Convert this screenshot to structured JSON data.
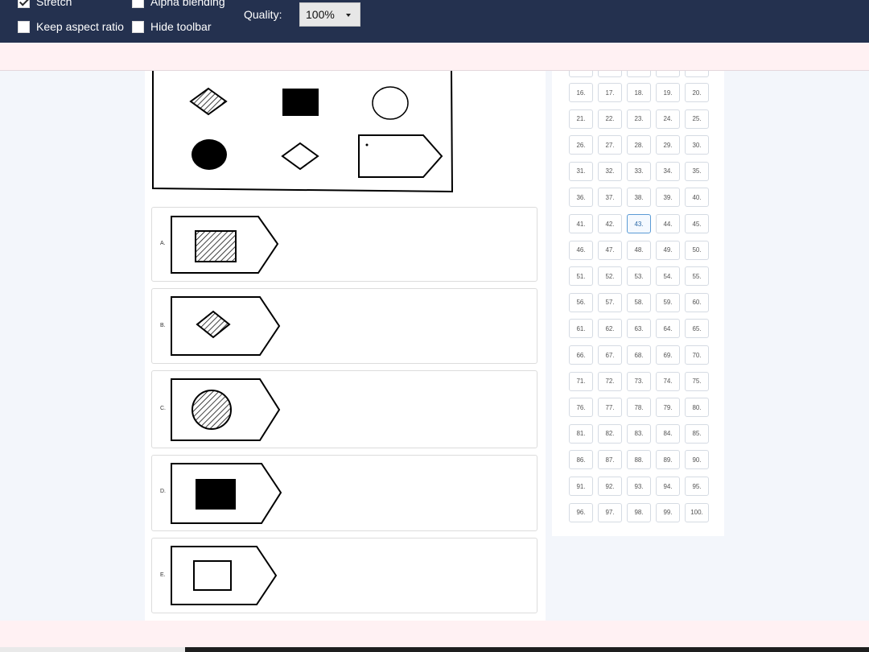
{
  "toolbar": {
    "stretch_label": "Stretch",
    "alpha_blending_label": "Alpha blending",
    "keep_aspect_label": "Keep aspect ratio",
    "hide_toolbar_label": "Hide toolbar",
    "quality_label": "Quality:",
    "quality_value": "100%",
    "stretch_checked": true,
    "alpha_blending_checked": false,
    "keep_aspect_checked": false,
    "hide_toolbar_checked": false
  },
  "question": {
    "shapes_row1": [
      "hatched-diamond",
      "black-square",
      "white-circle"
    ],
    "shapes_row2": [
      "black-circle",
      "white-diamond",
      "arrow-pentagon-with-dot"
    ]
  },
  "options": [
    {
      "letter": "A.",
      "inner_shape": "hatched-square"
    },
    {
      "letter": "B.",
      "inner_shape": "hatched-diamond"
    },
    {
      "letter": "C.",
      "inner_shape": "hatched-circle"
    },
    {
      "letter": "D.",
      "inner_shape": "black-square"
    },
    {
      "letter": "E.",
      "inner_shape": "white-square"
    }
  ],
  "navigator": {
    "numbers": [
      "16.",
      "17.",
      "18.",
      "19.",
      "20.",
      "21.",
      "22.",
      "23.",
      "24.",
      "25.",
      "26.",
      "27.",
      "28.",
      "29.",
      "30.",
      "31.",
      "32.",
      "33.",
      "34.",
      "35.",
      "36.",
      "37.",
      "38.",
      "39.",
      "40.",
      "41.",
      "42.",
      "43.",
      "44.",
      "45.",
      "46.",
      "47.",
      "48.",
      "49.",
      "50.",
      "51.",
      "52.",
      "53.",
      "54.",
      "55.",
      "56.",
      "57.",
      "58.",
      "59.",
      "60.",
      "61.",
      "62.",
      "63.",
      "64.",
      "65.",
      "66.",
      "67.",
      "68.",
      "69.",
      "70.",
      "71.",
      "72.",
      "73.",
      "74.",
      "75.",
      "76.",
      "77.",
      "78.",
      "79.",
      "80.",
      "81.",
      "82.",
      "83.",
      "84.",
      "85.",
      "86.",
      "87.",
      "88.",
      "89.",
      "90.",
      "91.",
      "92.",
      "93.",
      "94.",
      "95.",
      "96.",
      "97.",
      "98.",
      "99.",
      "100."
    ],
    "current": "43."
  },
  "colors": {
    "toolbar_bg": "#24314f",
    "pink_bar": "#fff1f3",
    "current_border": "#5b9bd5"
  }
}
